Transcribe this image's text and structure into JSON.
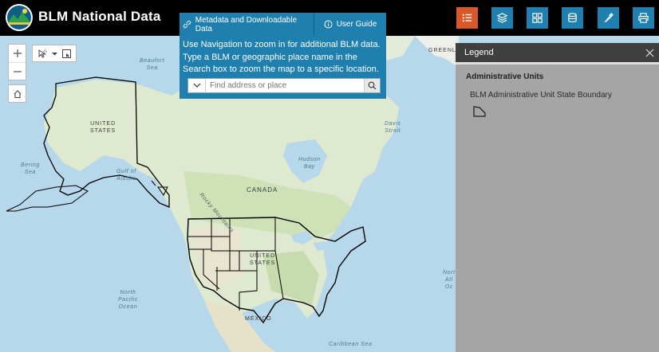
{
  "header": {
    "title": "BLM National Data",
    "colors": {
      "bar": "#000000",
      "button": "#1f7fae",
      "button_active": "#d8582a"
    },
    "buttons": [
      {
        "id": "legend",
        "icon": "list-icon",
        "active": true
      },
      {
        "id": "layers",
        "icon": "layers-icon",
        "active": false
      },
      {
        "id": "basemap",
        "icon": "grid-icon",
        "active": false
      },
      {
        "id": "data",
        "icon": "database-icon",
        "active": false
      },
      {
        "id": "draw",
        "icon": "brush-icon",
        "active": false
      },
      {
        "id": "print",
        "icon": "print-icon",
        "active": false
      }
    ]
  },
  "info": {
    "tab_metadata": "Metadata and Downloadable Data",
    "tab_guide": "User Guide",
    "text": "Use Navigation to zoom in for additional BLM data. Type a BLM or geographic place name in the Search box to zoom the map to a specific location.",
    "search_placeholder": "Find address or place"
  },
  "legend": {
    "title": "Legend",
    "layer_title": "Administrative Units",
    "item_label": "BLM Administrative Unit State Boundary"
  },
  "map_labels": {
    "beaufort": "Beaufort\nSea",
    "united_states_ak": "UNITED\nSTATES",
    "bering": "Bering\nSea",
    "gulf_alaska": "Gulf of\nAlaska",
    "canada": "CANADA",
    "hudson": "Hudson\nBay",
    "davis": "Davis\nStrait",
    "greenland": "GREENLAN",
    "rocky": "Rocky Mountains",
    "united_states": "UNITED\nSTATES",
    "north_pacific": "North\nPacific\nOcean",
    "mexico": "MÉXICO",
    "north_atlantic": "Nort\nAtl\nOc",
    "caribbean": "Caribbean Sea"
  }
}
